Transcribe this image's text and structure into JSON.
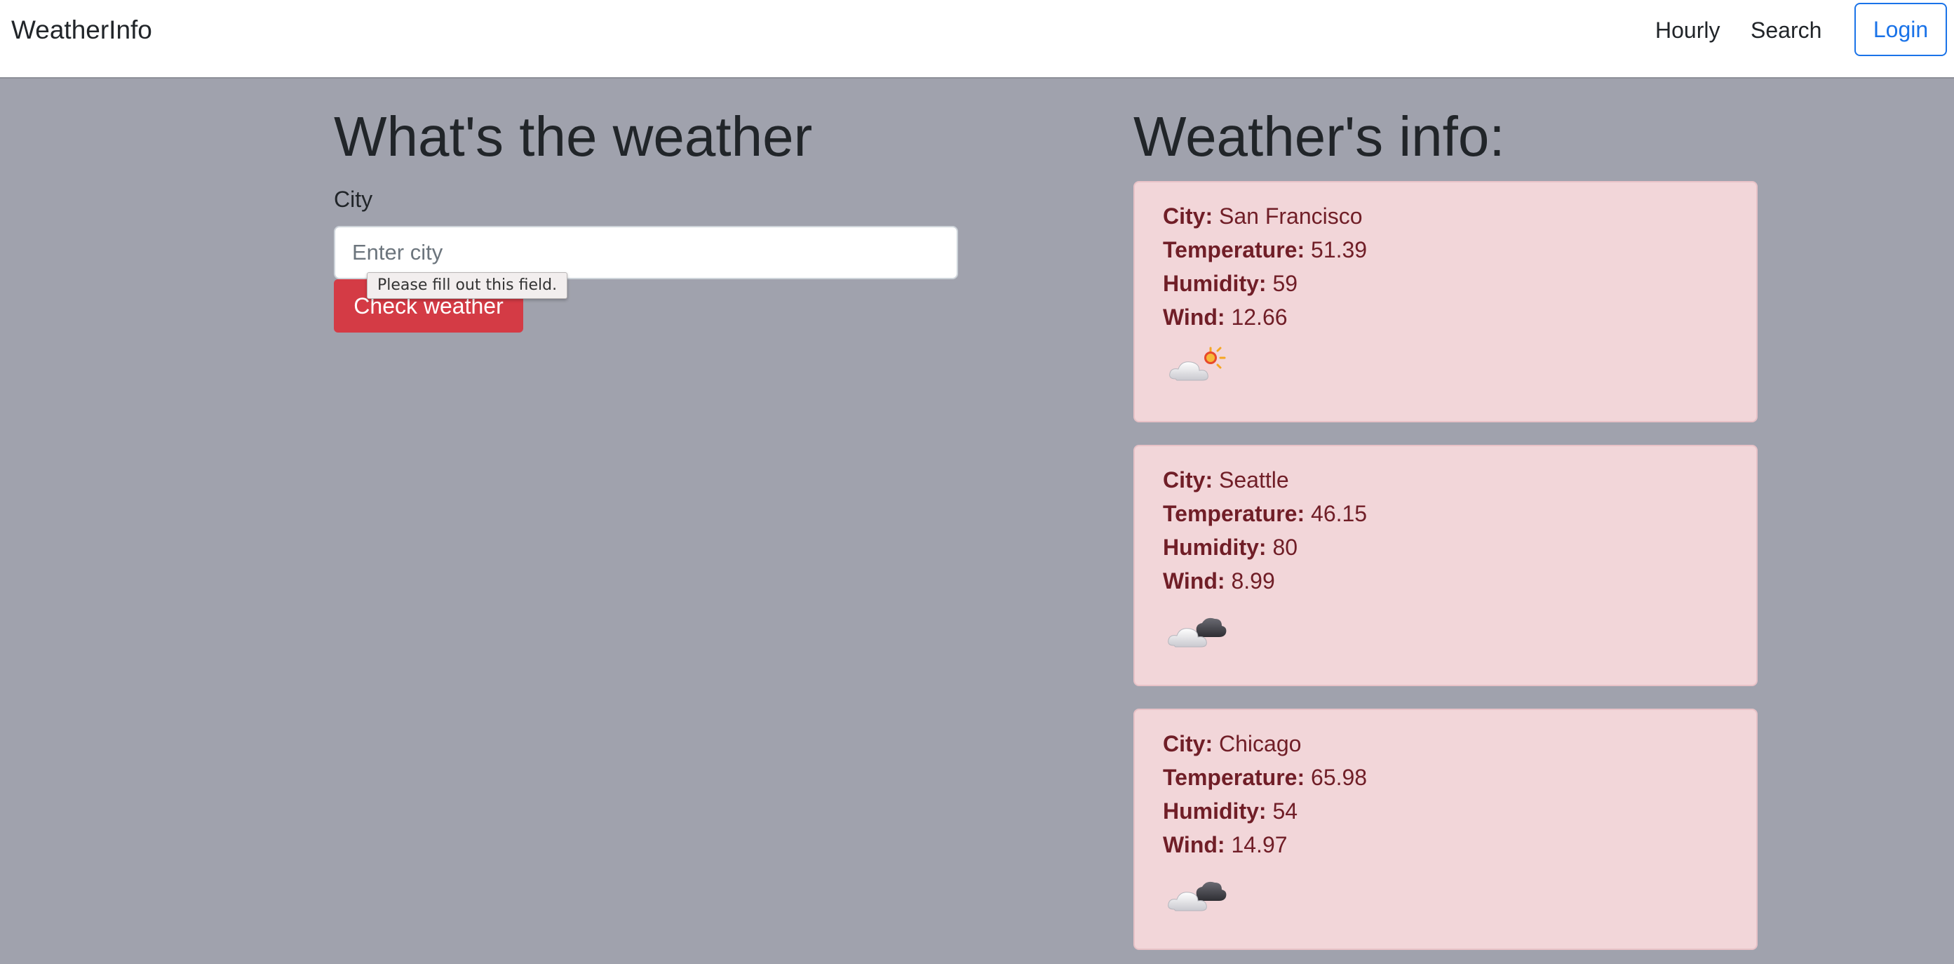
{
  "navbar": {
    "brand": "WeatherInfo",
    "links": [
      "Hourly",
      "Search"
    ],
    "login_label": "Login"
  },
  "form": {
    "heading": "What's the weather",
    "city_label": "City",
    "city_placeholder": "Enter city",
    "city_value": "",
    "button_label": "Check weather",
    "validation_tooltip": "Please fill out this field."
  },
  "results": {
    "heading": "Weather's info:",
    "field_labels": {
      "city": "City:",
      "temperature": "Temperature:",
      "humidity": "Humidity:",
      "wind": "Wind:"
    },
    "cards": [
      {
        "city": "San Francisco",
        "temperature": "51.39",
        "humidity": "59",
        "wind": "12.66",
        "icon": "partly-cloudy-day-icon"
      },
      {
        "city": "Seattle",
        "temperature": "46.15",
        "humidity": "80",
        "wind": "8.99",
        "icon": "clouds-icon"
      },
      {
        "city": "Chicago",
        "temperature": "65.98",
        "humidity": "54",
        "wind": "14.97",
        "icon": "clouds-icon"
      }
    ]
  },
  "colors": {
    "page_background": "#a0a2ad",
    "card_background": "#f2d6d9",
    "card_text": "#701e27",
    "primary_button": "#d43b45",
    "login_accent": "#1a73e8"
  }
}
